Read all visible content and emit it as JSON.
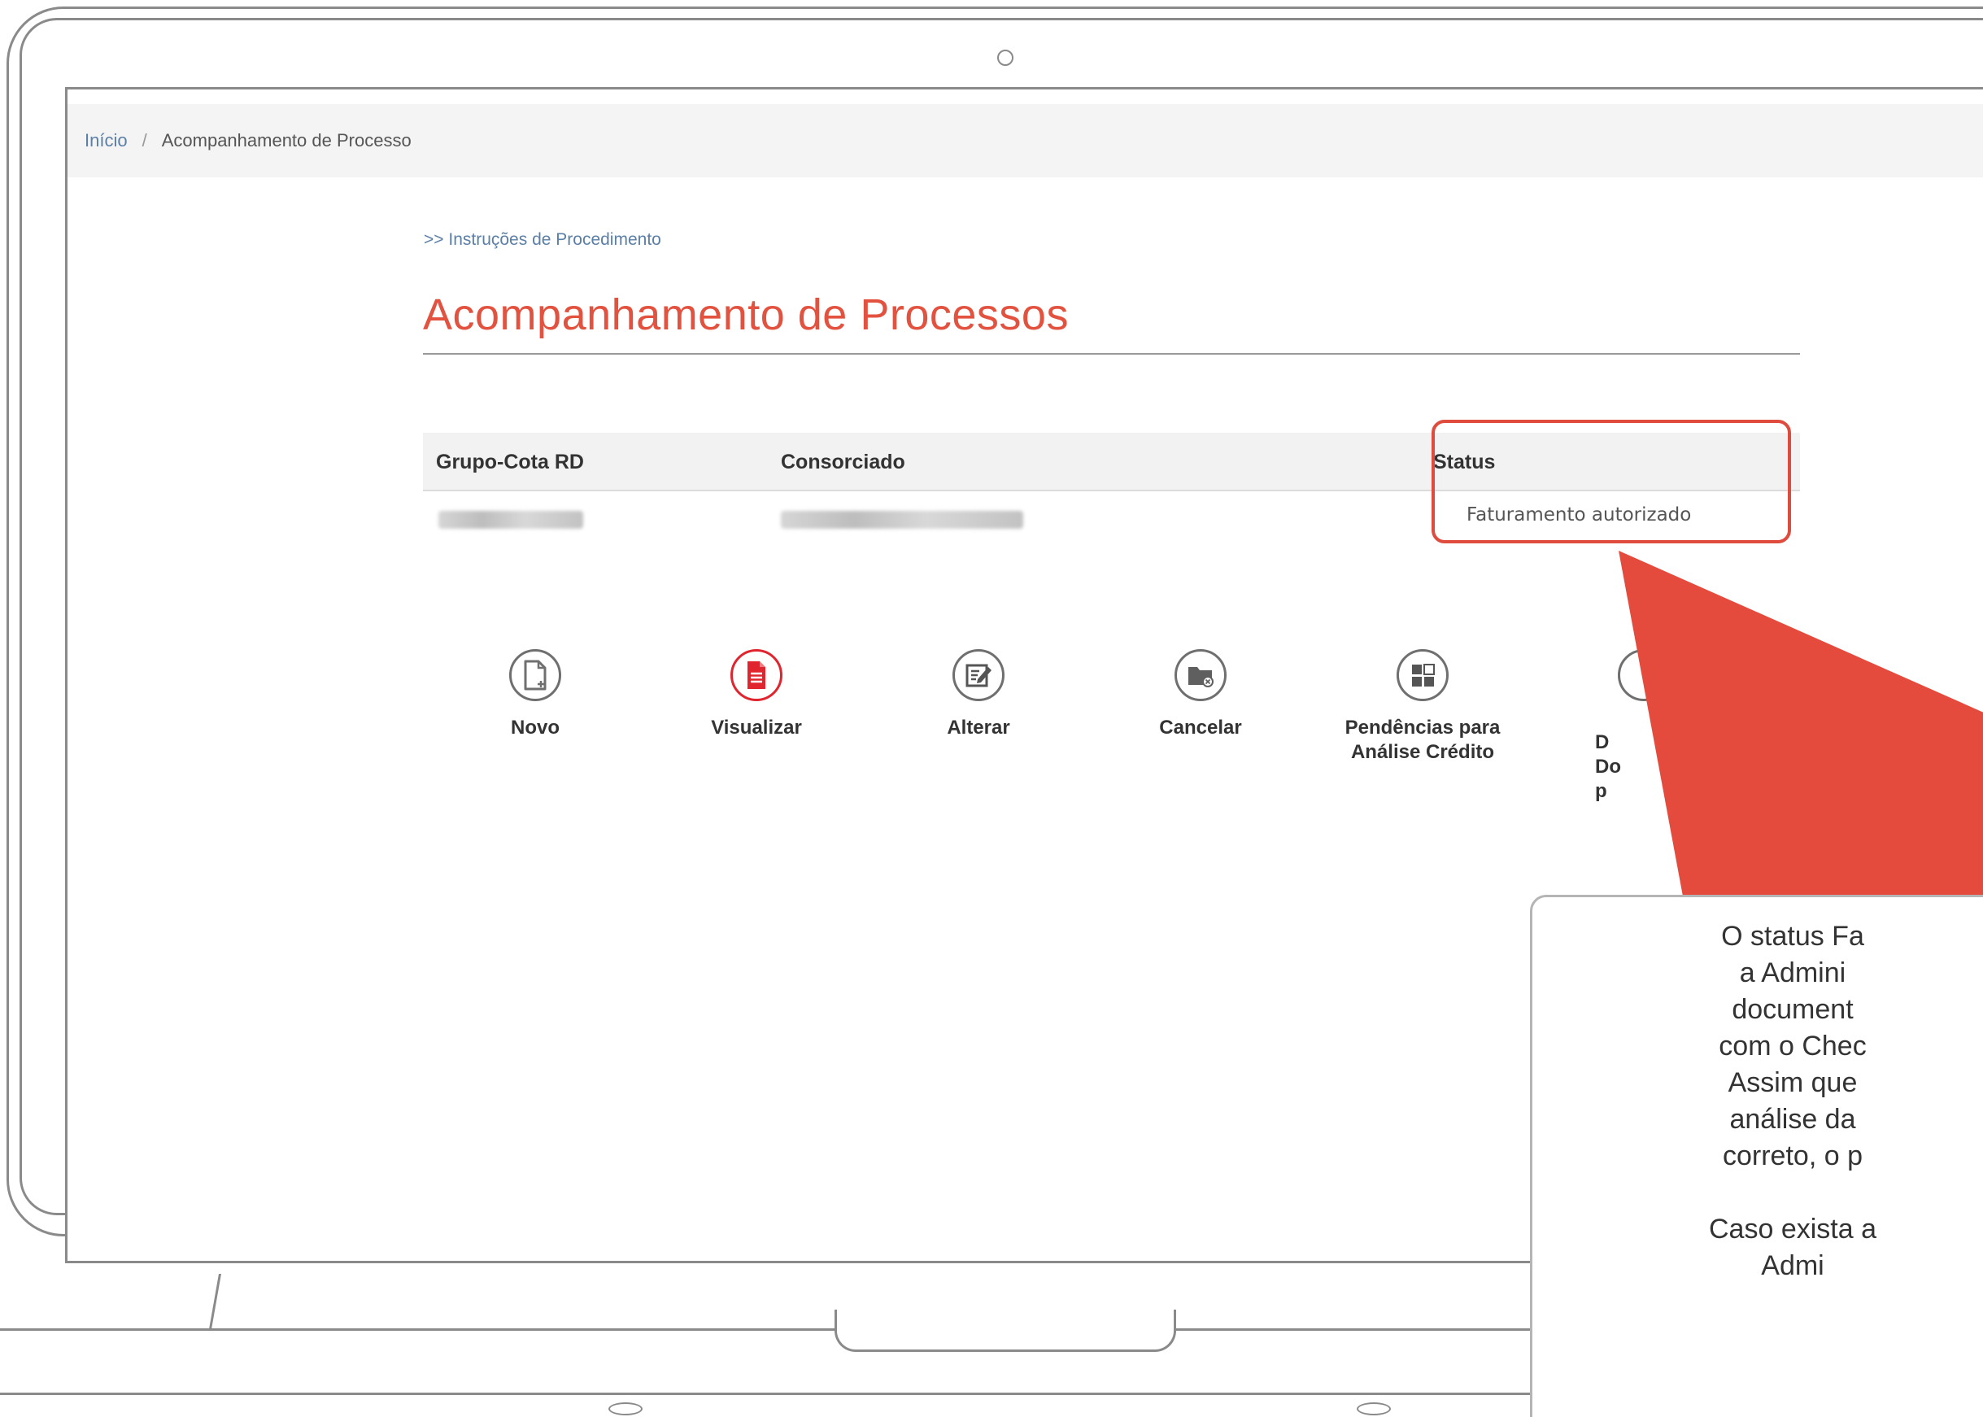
{
  "breadcrumb": {
    "home": "Início",
    "separator": "/",
    "current": "Acompanhamento de Processo"
  },
  "instructions_link": ">> Instruções de Procedimento",
  "page_title": "Acompanhamento de Processos",
  "table": {
    "headers": [
      "Grupo-Cota RD",
      "Consorciado",
      "Status"
    ],
    "rows": [
      {
        "status": "Faturamento autorizado"
      }
    ]
  },
  "actions": [
    {
      "label": "Novo",
      "icon": "new-document-icon"
    },
    {
      "label": "Visualizar",
      "icon": "view-document-icon"
    },
    {
      "label": "Alterar",
      "icon": "edit-icon"
    },
    {
      "label": "Cancelar",
      "icon": "cancel-folder-icon"
    },
    {
      "label": "Pendências para\nAnálise Crédito",
      "icon": "pending-grid-icon"
    },
    {
      "label": "D\nDo\np",
      "icon": "documents-icon"
    }
  ],
  "callout": {
    "text": "O status Fa\na Admini\ndocument\ncom o Chec\nAssim que\nanálise da\ncorreto, o p\n\nCaso exista a\nAdmi"
  },
  "colors": {
    "accent": "#e2523f",
    "highlight": "#df4b3c",
    "link": "#5b7fa6",
    "icon_active": "#e0252f"
  }
}
